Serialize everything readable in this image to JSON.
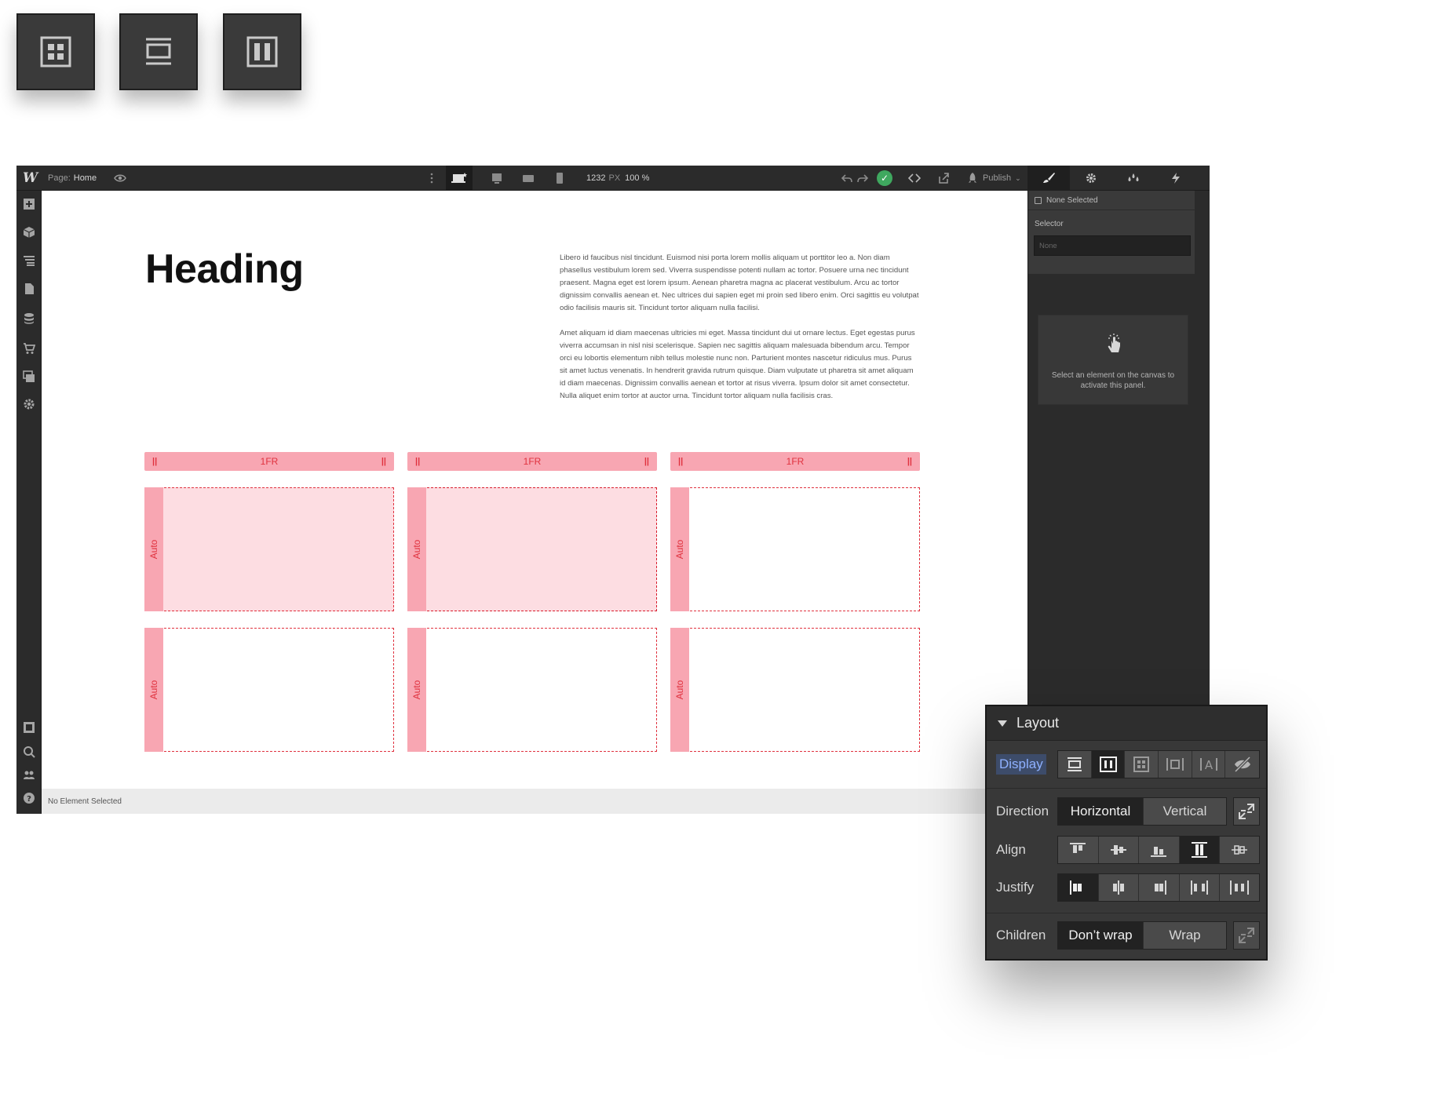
{
  "tiles": [
    {
      "name": "grid-layout-tile",
      "icon": "grid-icon"
    },
    {
      "name": "block-layout-tile",
      "icon": "block-icon"
    },
    {
      "name": "flex-layout-tile",
      "icon": "flex-columns-icon"
    }
  ],
  "topbar": {
    "logo": "W",
    "page_label": "Page:",
    "page_name": "Home",
    "width_value": "1232",
    "width_unit": "PX",
    "zoom": "100 %",
    "publish_label": "Publish"
  },
  "canvas": {
    "heading": "Heading",
    "paragraph1": "Libero id faucibus nisl tincidunt. Euismod nisi porta lorem mollis aliquam ut porttitor leo a. Non diam phasellus vestibulum lorem sed. Viverra suspendisse potenti nullam ac tortor. Posuere urna nec tincidunt praesent. Magna eget est lorem ipsum. Aenean pharetra magna ac placerat vestibulum. Arcu ac tortor dignissim convallis aenean et. Nec ultrices dui sapien eget mi proin sed libero enim. Orci sagittis eu volutpat odio facilisis mauris sit. Tincidunt tortor aliquam nulla facilisi.",
    "paragraph2": "Amet aliquam id diam maecenas ultricies mi eget. Massa tincidunt dui ut ornare lectus. Eget egestas purus viverra accumsan in nisl nisi scelerisque. Sapien nec sagittis aliquam malesuada bibendum arcu. Tempor orci eu lobortis elementum nibh tellus molestie nunc non. Parturient montes nascetur ridiculus mus. Purus sit amet luctus venenatis. In hendrerit gravida rutrum quisque. Diam vulputate ut pharetra sit amet aliquam id diam maecenas. Dignissim convallis aenean et tortor at risus viverra. Ipsum dolor sit amet consectetur. Nulla aliquet enim tortor at auctor urna. Tincidunt tortor aliquam nulla facilisis cras.",
    "grid_columns": [
      "1FR",
      "1FR",
      "1FR"
    ],
    "grip_glyph": "||",
    "row_label": "Auto"
  },
  "status_bar": "No Element Selected",
  "right_panel": {
    "none_selected": "None Selected",
    "selector_label": "Selector",
    "selector_placeholder": "None",
    "empty_message": "Select an element on the canvas to activate this panel."
  },
  "layout_panel": {
    "title": "Layout",
    "display_label": "Display",
    "direction_label": "Direction",
    "direction_options": [
      "Horizontal",
      "Vertical"
    ],
    "align_label": "Align",
    "justify_label": "Justify",
    "children_label": "Children",
    "children_options": [
      "Don’t wrap",
      "Wrap"
    ]
  },
  "colors": {
    "accent_pink": "#f8a6b2",
    "accent_red": "#e0323f",
    "success_green": "#3fa85f",
    "display_highlight": "#8fb1ff"
  }
}
